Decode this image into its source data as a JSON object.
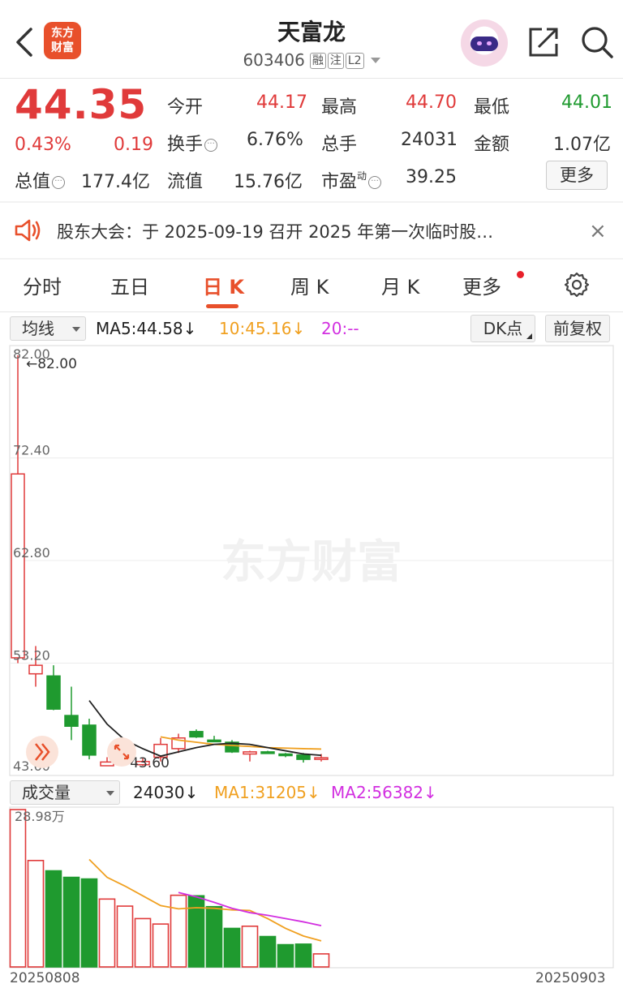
{
  "header": {
    "logo_line1": "东方",
    "logo_line2": "财富",
    "title": "天富龙",
    "code": "603406",
    "tags": [
      "融",
      "注",
      "L2"
    ]
  },
  "quote": {
    "price": "44.35",
    "change_pct": "0.43%",
    "change_val": "0.19",
    "open_label": "今开",
    "open_val": "44.17",
    "high_label": "最高",
    "high_val": "44.70",
    "low_label": "最低",
    "low_val": "44.01",
    "turnover_label": "换手",
    "turnover_val": "6.76%",
    "volume_label": "总手",
    "volume_val": "24031",
    "amount_label": "金额",
    "amount_val": "1.07亿",
    "mktcap_label": "总值",
    "mktcap_val": "177.4亿",
    "float_label": "流值",
    "float_val": "15.76亿",
    "pe_label": "市盈",
    "pe_sup": "动",
    "pe_val": "39.25",
    "more_label": "更多"
  },
  "notice": {
    "text": "股东大会：于 2025-09-19 召开 2025 年第一次临时股…",
    "close": "×"
  },
  "tabs": [
    "分时",
    "五日",
    "日 K",
    "周 K",
    "月 K",
    "更多"
  ],
  "active_tab": 2,
  "ma_bar": {
    "select": "均线",
    "ma5": "MA5:44.58↓",
    "ma10": "10:45.16↓",
    "ma20": "20:--",
    "dk": "DK点",
    "adjust": "前复权"
  },
  "vol_bar": {
    "select": "成交量",
    "vol": "24030↓",
    "ma1": "MA1:31205↓",
    "ma2": "MA2:56382↓"
  },
  "colors": {
    "up": "#e03a3a",
    "down": "#1f9a2f",
    "accent": "#e8502b",
    "ma5": "#222222",
    "ma10": "#f0a020",
    "ma20": "#d22fe0"
  },
  "watermark": "东方财富",
  "chart_data": [
    {
      "type": "candlestick",
      "title": "",
      "y_ticks": [
        "82.00",
        "72.40",
        "62.80",
        "53.20",
        "43.60"
      ],
      "ylim": [
        43.6,
        82.0
      ],
      "annotations": [
        {
          "text": "←82.00",
          "y": 82.0
        },
        {
          "text": "←43.60",
          "y": 43.6
        }
      ],
      "candles": [
        {
          "o": 53.7,
          "h": 82.0,
          "l": 53.2,
          "c": 70.9
        },
        {
          "o": 52.2,
          "h": 54.8,
          "l": 51.0,
          "c": 53.0
        },
        {
          "o": 52.0,
          "h": 53.0,
          "l": 48.8,
          "c": 48.9
        },
        {
          "o": 48.3,
          "h": 51.0,
          "l": 46.0,
          "c": 47.3
        },
        {
          "o": 47.4,
          "h": 48.0,
          "l": 44.2,
          "c": 44.6
        },
        {
          "o": 43.6,
          "h": 44.4,
          "l": 43.6,
          "c": 43.95
        },
        {
          "o": 44.1,
          "h": 45.4,
          "l": 43.8,
          "c": 44.4
        },
        {
          "o": 43.7,
          "h": 44.3,
          "l": 43.6,
          "c": 44.0
        },
        {
          "o": 44.4,
          "h": 46.2,
          "l": 44.0,
          "c": 45.6
        },
        {
          "o": 45.2,
          "h": 46.6,
          "l": 44.8,
          "c": 46.2
        },
        {
          "o": 46.8,
          "h": 47.0,
          "l": 46.2,
          "c": 46.3
        },
        {
          "o": 46.0,
          "h": 46.4,
          "l": 45.8,
          "c": 45.9
        },
        {
          "o": 45.8,
          "h": 46.0,
          "l": 44.8,
          "c": 44.9
        },
        {
          "o": 44.7,
          "h": 45.0,
          "l": 44.0,
          "c": 44.9
        },
        {
          "o": 44.9,
          "h": 45.0,
          "l": 44.7,
          "c": 44.8
        },
        {
          "o": 44.7,
          "h": 44.8,
          "l": 44.4,
          "c": 44.6
        },
        {
          "o": 44.6,
          "h": 44.8,
          "l": 43.9,
          "c": 44.2
        },
        {
          "o": 44.2,
          "h": 44.7,
          "l": 44.0,
          "c": 44.35
        }
      ],
      "ma5": [
        null,
        null,
        null,
        null,
        49.7,
        47.5,
        46.0,
        45.2,
        44.5,
        44.9,
        45.3,
        45.6,
        45.7,
        45.6,
        45.3,
        45.0,
        44.7,
        44.58
      ],
      "ma10": [
        null,
        null,
        null,
        null,
        null,
        null,
        null,
        null,
        46.3,
        46.0,
        45.8,
        45.6,
        45.5,
        45.4,
        45.3,
        45.25,
        45.2,
        45.16
      ]
    },
    {
      "type": "bar",
      "title": "",
      "y_top_label": "28.98万",
      "ylim": [
        0,
        289800
      ],
      "x_start": "20250808",
      "x_end": "20250903",
      "volumes": [
        289800,
        196000,
        177000,
        165000,
        162000,
        125000,
        112000,
        89000,
        79000,
        132000,
        131000,
        111000,
        71000,
        75000,
        56000,
        41000,
        42000,
        24030
      ],
      "ma1": [
        null,
        null,
        null,
        null,
        198000,
        165000,
        149000,
        131000,
        113000,
        107000,
        109000,
        108000,
        105000,
        104000,
        89000,
        71000,
        57000,
        48000
      ],
      "ma2": [
        null,
        null,
        null,
        null,
        null,
        null,
        null,
        null,
        null,
        137000,
        129000,
        119000,
        108000,
        100000,
        95000,
        89000,
        83000,
        76000
      ]
    }
  ]
}
